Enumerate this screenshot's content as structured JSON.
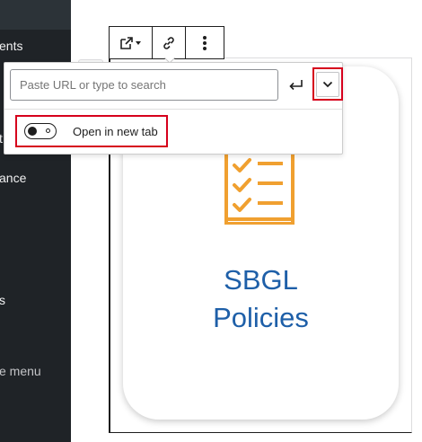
{
  "sidebar": {
    "items": [
      {
        "label": "ents"
      },
      {
        "label": "t"
      },
      {
        "label": "ance"
      },
      {
        "label": "s"
      },
      {
        "label": "e menu"
      }
    ]
  },
  "block_toolbar": {
    "buttons": [
      {
        "icon": "external-link-icon",
        "label": ""
      },
      {
        "icon": "link-icon",
        "label": ""
      },
      {
        "icon": "more-vertical-icon",
        "label": ""
      }
    ]
  },
  "link_popover": {
    "url_value": "",
    "url_placeholder": "Paste URL or type to search",
    "submit_icon": "enter-icon",
    "settings_toggle_icon": "chevron-down-icon",
    "open_in_new_tab": {
      "label": "Open in new tab",
      "checked": false
    }
  },
  "card": {
    "icon": "checklist-clipboard-icon",
    "title_line1": "SBGL",
    "title_line2": "Policies"
  },
  "colors": {
    "accent_blue": "#1e5fa8",
    "icon_orange": "#f0a030",
    "highlight_red": "#d6001c",
    "sidebar_bg": "#1f2327"
  }
}
